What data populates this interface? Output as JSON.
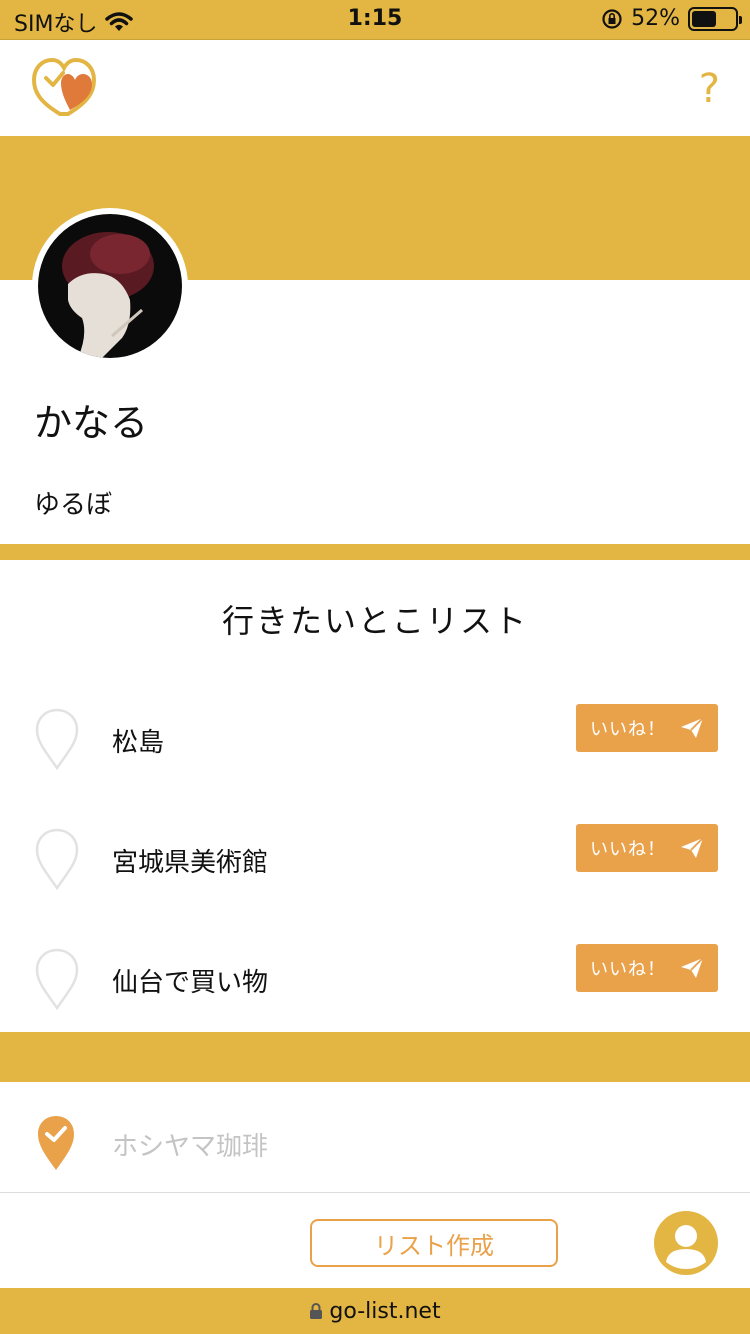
{
  "status_bar": {
    "carrier": "SIMなし",
    "time": "1:15",
    "battery_percent": "52%"
  },
  "header": {
    "logo": "heart-check-logo",
    "help_label": "?"
  },
  "profile": {
    "name": "かなる",
    "bio": "ゆるぼ"
  },
  "wish_list": {
    "title": "行きたいとこリスト",
    "items": [
      {
        "label": "松島",
        "like_label": "いいね！"
      },
      {
        "label": "宮城県美術館",
        "like_label": "いいね！"
      },
      {
        "label": "仙台で買い物",
        "like_label": "いいね！"
      }
    ]
  },
  "visited": {
    "label": "ホシヤマ珈琲"
  },
  "bottom_bar": {
    "create_list_label": "リスト作成"
  },
  "browser": {
    "url": "go-list.net"
  },
  "colors": {
    "brand_yellow": "#E3B643",
    "accent_orange": "#E9A14A"
  }
}
